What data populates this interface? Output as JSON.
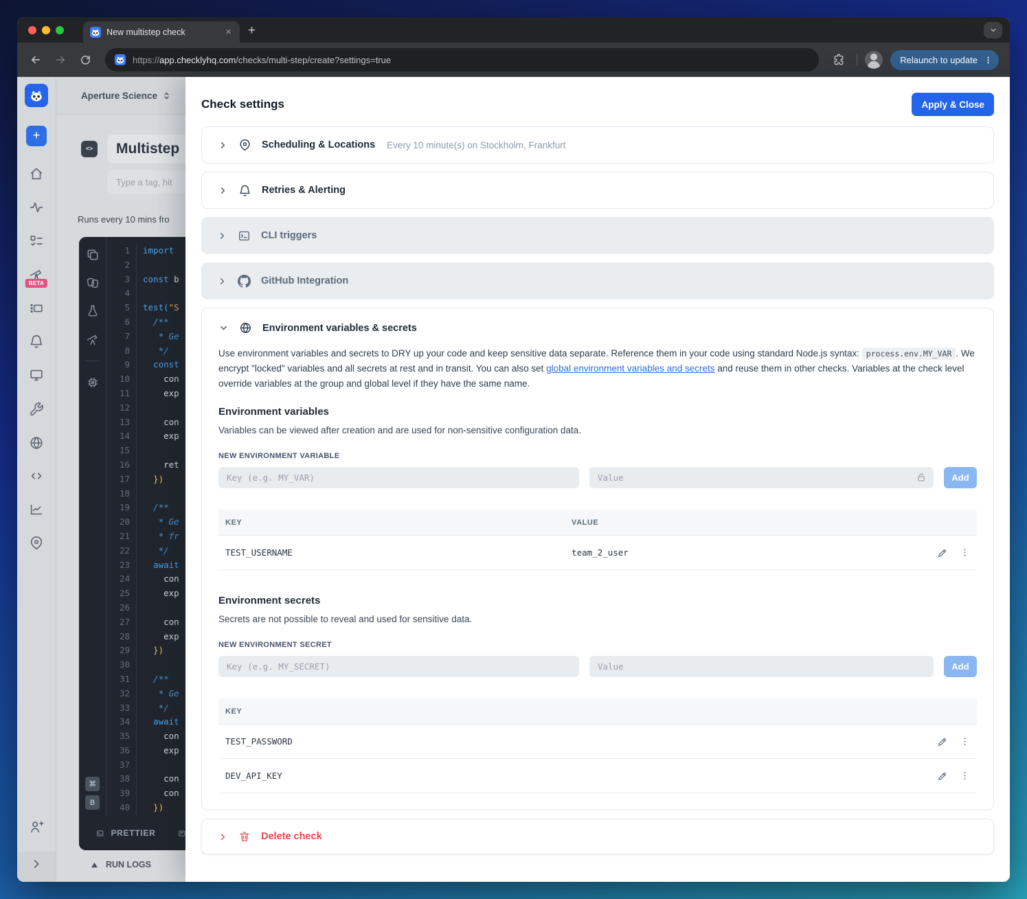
{
  "browser": {
    "tab_title": "New multistep check",
    "url_scheme": "https://",
    "url_host": "app.checklyhq.com",
    "url_path": "/checks/multi-step/create?settings=true",
    "relaunch_label": "Relaunch to update"
  },
  "app": {
    "account_name": "Aperture Science",
    "page_title": "Multistep",
    "tag_placeholder": "Type a tag, hit",
    "schedule_note": "Runs every 10 mins fro",
    "beta_badge": "BETA",
    "code_badge": "<>",
    "editor": {
      "kbd1": "⌘",
      "kbd2": "B",
      "prettier_label": "PRETTIER",
      "run_logs_label": "RUN LOGS",
      "lines": [
        {
          "n": 1,
          "t": "import",
          "c": "kw"
        },
        {
          "n": 2,
          "t": ""
        },
        {
          "n": 3,
          "t": "const ",
          "c": "kw",
          "t2": "b",
          "c2": "tx"
        },
        {
          "n": 4,
          "t": ""
        },
        {
          "n": 5,
          "t": "test(",
          "c": "kw",
          "t2": "\"S",
          "c2": "str"
        },
        {
          "n": 6,
          "t": "  /**",
          "c": "cm"
        },
        {
          "n": 7,
          "t": "   * Ge",
          "c": "cm"
        },
        {
          "n": 8,
          "t": "   */",
          "c": "cm"
        },
        {
          "n": 9,
          "t": "  const",
          "c": "kw"
        },
        {
          "n": 10,
          "t": "    con",
          "c": "tx"
        },
        {
          "n": 11,
          "t": "    exp",
          "c": "tx"
        },
        {
          "n": 12,
          "t": ""
        },
        {
          "n": 13,
          "t": "    con",
          "c": "tx"
        },
        {
          "n": 14,
          "t": "    exp",
          "c": "tx"
        },
        {
          "n": 15,
          "t": ""
        },
        {
          "n": 16,
          "t": "    ret",
          "c": "tx"
        },
        {
          "n": 17,
          "t": "  })",
          "c": "br"
        },
        {
          "n": 18,
          "t": ""
        },
        {
          "n": 19,
          "t": "  /**",
          "c": "cm"
        },
        {
          "n": 20,
          "t": "   * Ge",
          "c": "cm"
        },
        {
          "n": 21,
          "t": "   * fr",
          "c": "cm"
        },
        {
          "n": 22,
          "t": "   */",
          "c": "cm"
        },
        {
          "n": 23,
          "t": "  await",
          "c": "kw"
        },
        {
          "n": 24,
          "t": "    con",
          "c": "tx"
        },
        {
          "n": 25,
          "t": "    exp",
          "c": "tx"
        },
        {
          "n": 26,
          "t": ""
        },
        {
          "n": 27,
          "t": "    con",
          "c": "tx"
        },
        {
          "n": 28,
          "t": "    exp",
          "c": "tx"
        },
        {
          "n": 29,
          "t": "  })",
          "c": "br"
        },
        {
          "n": 30,
          "t": ""
        },
        {
          "n": 31,
          "t": "  /**",
          "c": "cm"
        },
        {
          "n": 32,
          "t": "   * Ge",
          "c": "cm"
        },
        {
          "n": 33,
          "t": "   */",
          "c": "cm"
        },
        {
          "n": 34,
          "t": "  await",
          "c": "kw"
        },
        {
          "n": 35,
          "t": "    con",
          "c": "tx"
        },
        {
          "n": 36,
          "t": "    exp",
          "c": "tx"
        },
        {
          "n": 37,
          "t": ""
        },
        {
          "n": 38,
          "t": "    con",
          "c": "tx"
        },
        {
          "n": 39,
          "t": "    con",
          "c": "tx"
        },
        {
          "n": 40,
          "t": "  })",
          "c": "br"
        }
      ]
    }
  },
  "modal": {
    "title": "Check settings",
    "apply_label": "Apply & Close",
    "scheduling": {
      "label": "Scheduling & Locations",
      "subtitle": "Every 10 minute(s) on Stockholm, Frankfurt"
    },
    "retries": {
      "label": "Retries & Alerting"
    },
    "cli": {
      "label": "CLI triggers"
    },
    "github": {
      "label": "GitHub Integration"
    },
    "env": {
      "title": "Environment variables & secrets",
      "desc1": "Use environment variables and secrets to DRY up your code and keep sensitive data separate. Reference them in your code using standard Node.js syntax: ",
      "desc_code": "process.env.MY_VAR",
      "desc2": ". We encrypt \"locked\" variables and all secrets at rest and in transit. You can also set ",
      "desc_link": "global environment variables and secrets",
      "desc3": " and reuse them in other checks. Variables at the check level override variables at the group and global level if they have the same name.",
      "variables": {
        "heading": "Environment variables",
        "sub": "Variables can be viewed after creation and are used for non-sensitive configuration data.",
        "form_label": "NEW ENVIRONMENT VARIABLE",
        "key_placeholder": "Key (e.g. MY_VAR)",
        "value_placeholder": "Value",
        "add_label": "Add",
        "col_key": "KEY",
        "col_value": "VALUE",
        "rows": [
          {
            "key": "TEST_USERNAME",
            "value": "team_2_user"
          }
        ]
      },
      "secrets": {
        "heading": "Environment secrets",
        "sub": "Secrets are not possible to reveal and used for sensitive data.",
        "form_label": "NEW ENVIRONMENT SECRET",
        "key_placeholder": "Key (e.g. MY_SECRET)",
        "value_placeholder": "Value",
        "add_label": "Add",
        "col_key": "KEY",
        "rows": [
          {
            "key": "TEST_PASSWORD"
          },
          {
            "key": "DEV_API_KEY"
          }
        ]
      }
    },
    "delete": {
      "label": "Delete check"
    }
  },
  "colors": {
    "accent": "#2563eb",
    "add_button": "#8ab6f2",
    "danger": "#e5484d",
    "beta": "#e0527f",
    "relaunch": "#33608f"
  }
}
